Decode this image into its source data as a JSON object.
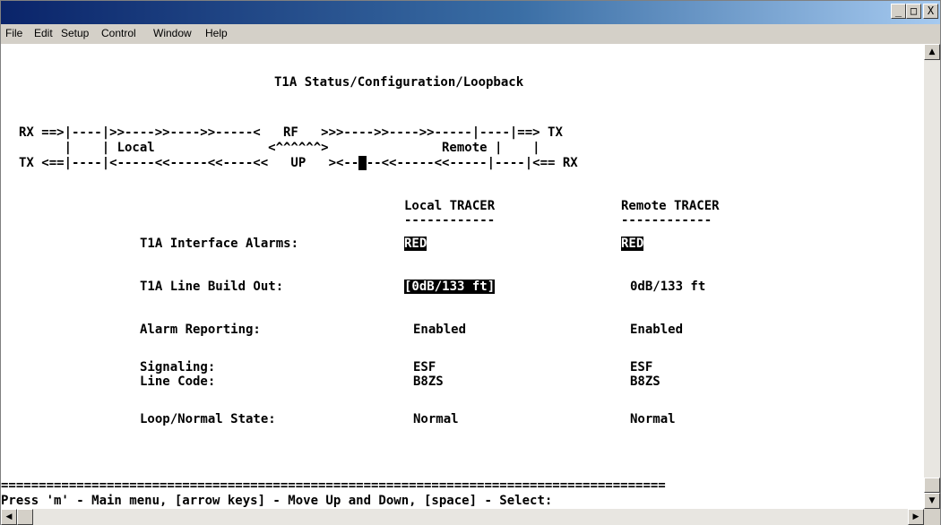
{
  "window": {
    "controls": {
      "minimize": "_",
      "maximize": "□",
      "close": "X"
    }
  },
  "menu": [
    "File",
    "Edit",
    "Setup",
    "Control",
    "Window",
    "Help"
  ],
  "screen": {
    "title": "T1A Status/Configuration/Loopback",
    "diagram": {
      "line1": "RX ==>|----|>>---->>---->>-----<   RF   >>>---->>---->>-----|----|==> TX",
      "line2": "      |    | Local               <^^^^^^>               Remote |    |",
      "line3_left": "TX <==|----|<-----<<-----<<----<<   UP   ><--",
      "line3_cursor": " ",
      "line3_right": "--<<-----<<-----|----|<== RX"
    },
    "headers": {
      "local": "Local TRACER",
      "remote": "Remote TRACER",
      "underline": "------------"
    },
    "rows": [
      {
        "label": "T1A Interface Alarms:",
        "local": "RED",
        "remote": "RED"
      },
      {
        "label": "T1A Line Build Out:",
        "local": "[0dB/133 ft]",
        "remote": "0dB/133 ft"
      },
      {
        "label": "Alarm Reporting:",
        "local": "Enabled",
        "remote": "Enabled"
      },
      {
        "label": "Signaling:",
        "local": "ESF",
        "remote": "ESF"
      },
      {
        "label": "Line Code:",
        "local": "B8ZS",
        "remote": "B8ZS"
      },
      {
        "label": "Loop/Normal State:",
        "local": "Normal",
        "remote": "Normal"
      }
    ],
    "separator": "========================================================================================",
    "footer": "Press 'm' - Main menu, [arrow keys] - Move Up and Down, [space] - Select:"
  },
  "scroll_icons": {
    "up": "▲",
    "down": "▼",
    "left": "◀",
    "right": "▶"
  }
}
